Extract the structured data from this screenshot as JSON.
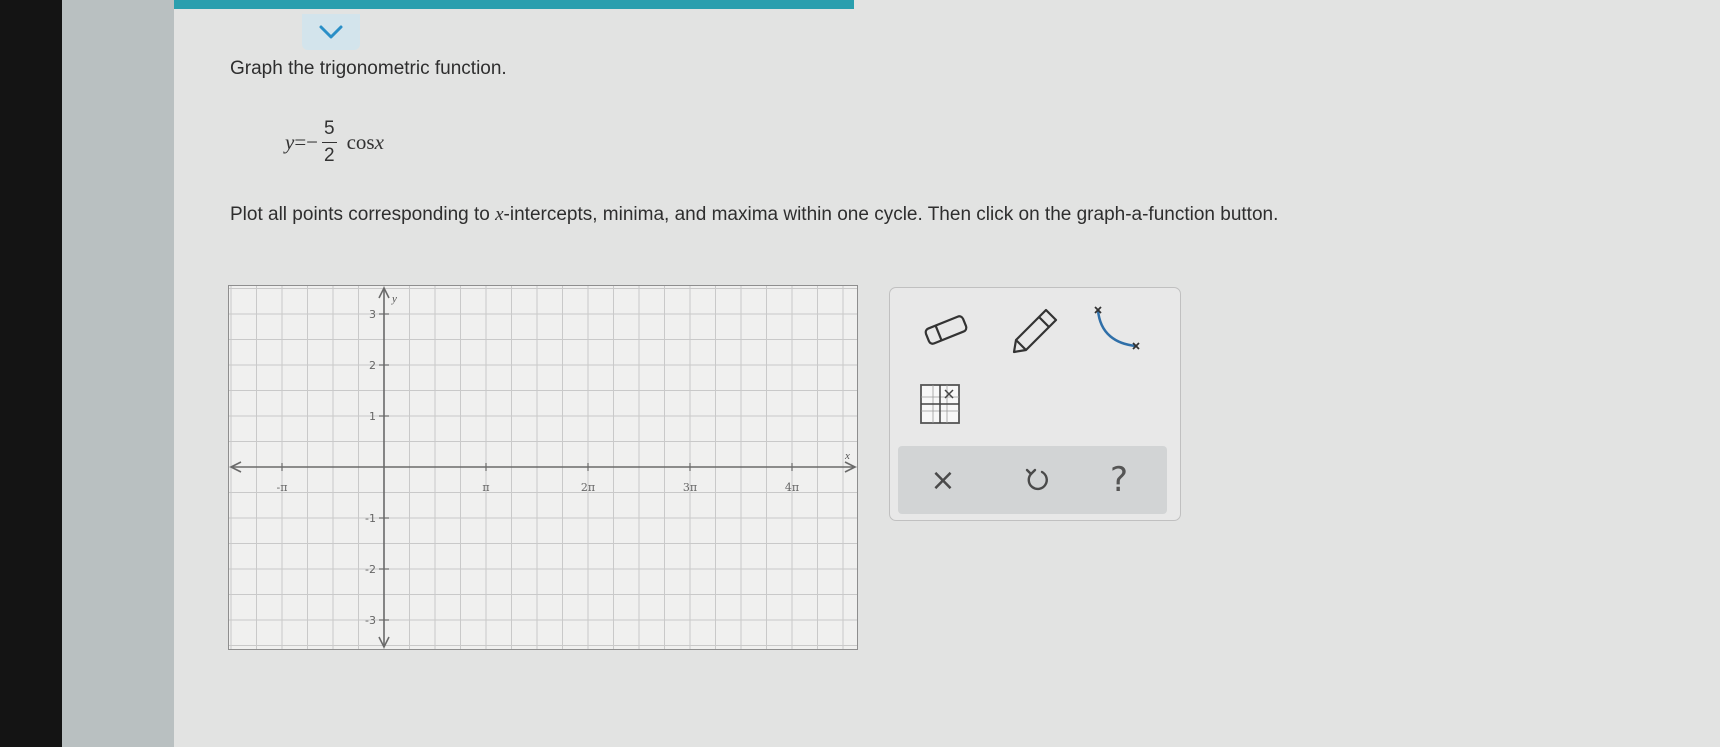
{
  "problem": {
    "instruction": "Graph the trigonometric function.",
    "equation": {
      "lhs": "y",
      "equals": "=",
      "sign": "−",
      "numerator": "5",
      "denominator": "2",
      "func": "cos",
      "arg": "x"
    },
    "instruction2": {
      "before": "Plot all points corresponding to ",
      "var": "x",
      "after": "-intercepts, minima, and maxima within one cycle. Then click on the graph-a-function button."
    }
  },
  "graph": {
    "x_axis_label": "x",
    "y_axis_label": "y",
    "x_ticks": [
      "-π",
      "π",
      "2π",
      "3π",
      "4π"
    ],
    "y_ticks": [
      "3",
      "2",
      "1",
      "-1",
      "-2",
      "-3"
    ]
  },
  "toolbox": {
    "tools": [
      "eraser-icon",
      "pencil-icon",
      "curve-icon",
      "graph-function-icon"
    ],
    "actions": {
      "clear_label": "×",
      "help_label": "?"
    }
  },
  "colors": {
    "topbar": "#2a9fae",
    "grid_line": "#c9c9c9",
    "axis": "#6a6a6a"
  }
}
